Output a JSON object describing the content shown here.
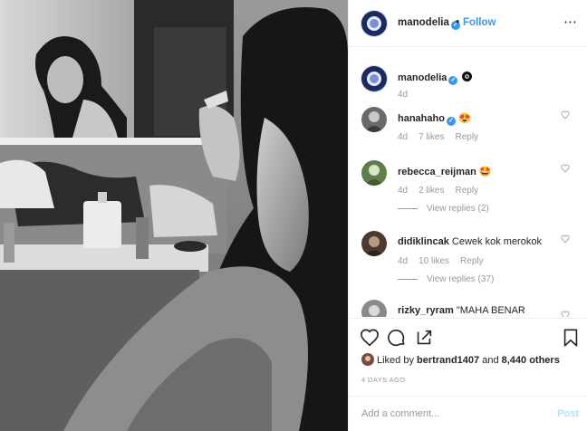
{
  "post": {
    "author": "manodelia",
    "follow_label": "Follow",
    "dot": "•",
    "more_icon": "⋯"
  },
  "caption": {
    "username": "manodelia",
    "time": "4d"
  },
  "comments": [
    {
      "username": "hanahaho",
      "verified": true,
      "text": "😍",
      "time": "4d",
      "likes": "7 likes",
      "reply": "Reply",
      "replies": ""
    },
    {
      "username": "rebecca_reijman",
      "verified": false,
      "text": "🤩",
      "time": "4d",
      "likes": "2 likes",
      "reply": "Reply",
      "replies": "View replies (2)"
    },
    {
      "username": "didiklincak",
      "verified": false,
      "text": "Cewek kok merokok",
      "time": "4d",
      "likes": "10 likes",
      "reply": "Reply",
      "replies": "View replies (37)"
    },
    {
      "username": "rizky_ryram",
      "verified": false,
      "text": "\"MAHA BENAR",
      "time": "",
      "likes": "",
      "reply": "",
      "replies": ""
    }
  ],
  "likes_line": {
    "prefix": "Liked by",
    "user": "bertrand1407",
    "middle": "and",
    "others": "8,440 others"
  },
  "date": "4 DAYS AGO",
  "add_comment": {
    "placeholder": "Add a comment...",
    "post_label": "Post"
  },
  "colors": {
    "accent": "#3897f0",
    "heart_like": "#e0245e",
    "muted": "#999999",
    "post_disabled": "#b2dffc"
  },
  "icons": {
    "heart": "heart-icon",
    "comment": "comment-bubble-icon",
    "share": "share-icon",
    "bookmark": "bookmark-icon"
  }
}
